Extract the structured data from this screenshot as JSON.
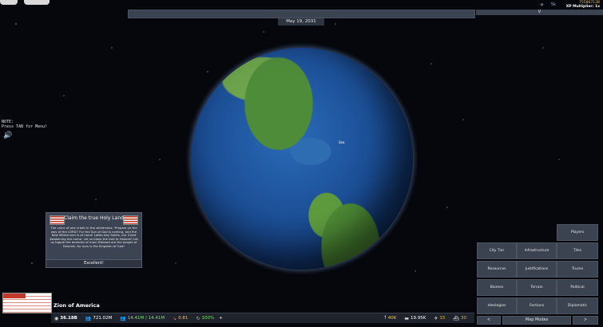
{
  "header": {
    "date": "May 19, 2031",
    "panel_chevron": "V"
  },
  "stats_top": {
    "plane_value": "5k",
    "money_line": "75586713B",
    "xp_line": "XP Multiplier: 1x"
  },
  "note": {
    "text": "NOTE:\nPress TAB for Menu!"
  },
  "map": {
    "label": "Sea"
  },
  "popup": {
    "title": "Claim the true Holy Land",
    "body": "The voice of one crieth in the wilderness: 'Prepare ye the way of the LORD!' For the Son of God is coming, and the New Millennium is at hand! Latter-day Saints, our Great Awakening has come. Let us blaze the trail to Heaven! Let us topple the enemies of man! Blessed are the people of Deseret, for ours is the Kingdom of God!",
    "button": "Excellent!"
  },
  "nation": {
    "name": "Zion of America"
  },
  "bottom_bar": {
    "money": "36.18B",
    "population": "721.02M",
    "manpower": "14.41M / 14.41M",
    "stability_change": "0.81",
    "stability": "100%",
    "plus": "+",
    "troops": "40K",
    "mil_value": "19.95K",
    "aircraft": "15",
    "ships": "30"
  },
  "right_menu": {
    "players": "Players",
    "city_tier": "City Tier",
    "infrastructure": "Infrastructure",
    "tiles": "Tiles",
    "resources": "Resources",
    "justifications": "Justifications",
    "truces": "Truces",
    "biomes": "Biomes",
    "terrain": "Terrain",
    "political": "Political",
    "ideologies": "Ideologies",
    "factions": "Factions",
    "diplomatic": "Diplomatic",
    "prev": "<",
    "map_modes": "Map Modes",
    "next": ">"
  },
  "colors": {
    "panel": "#3b4250",
    "panel_border": "#4d5564",
    "gold": "#f0c060",
    "green": "#7fdc7f",
    "red": "#e86c6c"
  },
  "icons": [
    "menu-icon",
    "back-icon",
    "plane-icon",
    "speaker-icon",
    "money-icon",
    "population-icon",
    "manpower-icon",
    "stability-icon",
    "troops-icon",
    "tank-icon",
    "aircraft-icon",
    "ship-icon"
  ]
}
